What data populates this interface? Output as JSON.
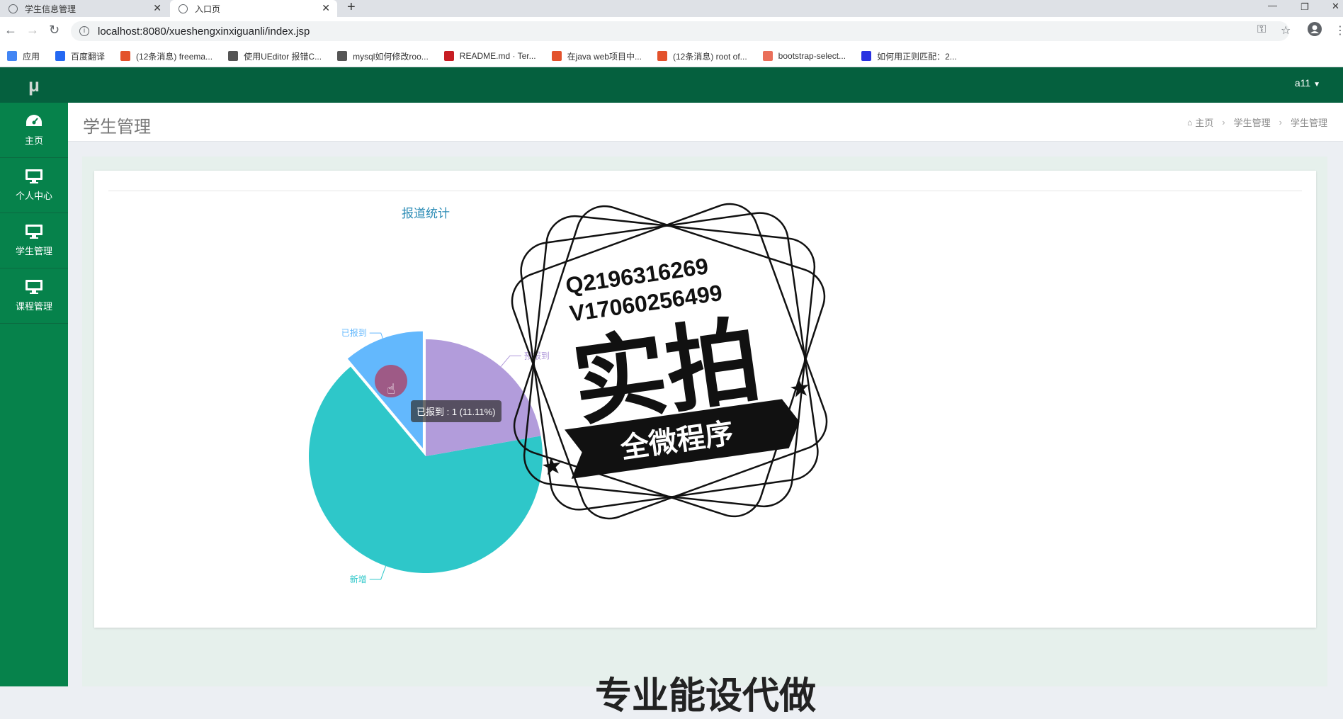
{
  "browser": {
    "tabs": [
      {
        "label": "学生信息管理",
        "active": false
      },
      {
        "label": "入口页",
        "active": true
      }
    ],
    "url": "localhost:8080/xueshengxinxiguanli/index.jsp",
    "bookmarks": [
      {
        "label": "应用",
        "icon": "apps-icon",
        "color": "#4285f4"
      },
      {
        "label": "百度翻译",
        "icon": "baidu-translate-icon",
        "color": "#2468f2"
      },
      {
        "label": "(12条消息) freema...",
        "icon": "csdn-icon",
        "color": "#e3522c"
      },
      {
        "label": "使用UEditor 报错C...",
        "icon": "leaf-icon",
        "color": "#555555"
      },
      {
        "label": "mysql如何修改roo...",
        "icon": "leaf-icon",
        "color": "#555555"
      },
      {
        "label": "README.md · Ter...",
        "icon": "gitee-icon",
        "color": "#c71d23"
      },
      {
        "label": "在java web项目中...",
        "icon": "csdn-icon",
        "color": "#e3522c"
      },
      {
        "label": "(12条消息) root of...",
        "icon": "csdn-icon",
        "color": "#e3522c"
      },
      {
        "label": "bootstrap-select...",
        "icon": "jianshu-icon",
        "color": "#ea6f5a"
      },
      {
        "label": "如何用正则匹配：2...",
        "icon": "baidu-paw-icon",
        "color": "#2932e1"
      }
    ]
  },
  "app": {
    "logo": "μ",
    "user": "a11",
    "sidebar": [
      {
        "label": "主页",
        "icon": "dashboard-icon"
      },
      {
        "label": "个人中心",
        "icon": "monitor-icon"
      },
      {
        "label": "学生管理",
        "icon": "monitor-icon"
      },
      {
        "label": "课程管理",
        "icon": "monitor-icon"
      }
    ],
    "page_title": "学生管理",
    "breadcrumb": [
      "主页",
      "学生管理",
      "学生管理"
    ]
  },
  "chart_data": {
    "type": "pie",
    "title": "报道统计",
    "slices": [
      {
        "name": "已报到",
        "value": 1,
        "color": "#63b8fd"
      },
      {
        "name": "新增",
        "value": 6,
        "color": "#2ec7c9"
      },
      {
        "name": "预报到",
        "value": 2,
        "color": "#b29cdb"
      }
    ],
    "tooltip": "已报到 : 1 (11.11%)"
  },
  "watermark": {
    "line1": "Q219631626​9",
    "line2": "V17060256499",
    "big": "实拍",
    "banner": "全微程序"
  },
  "bottom_text": "专业能设代做"
}
